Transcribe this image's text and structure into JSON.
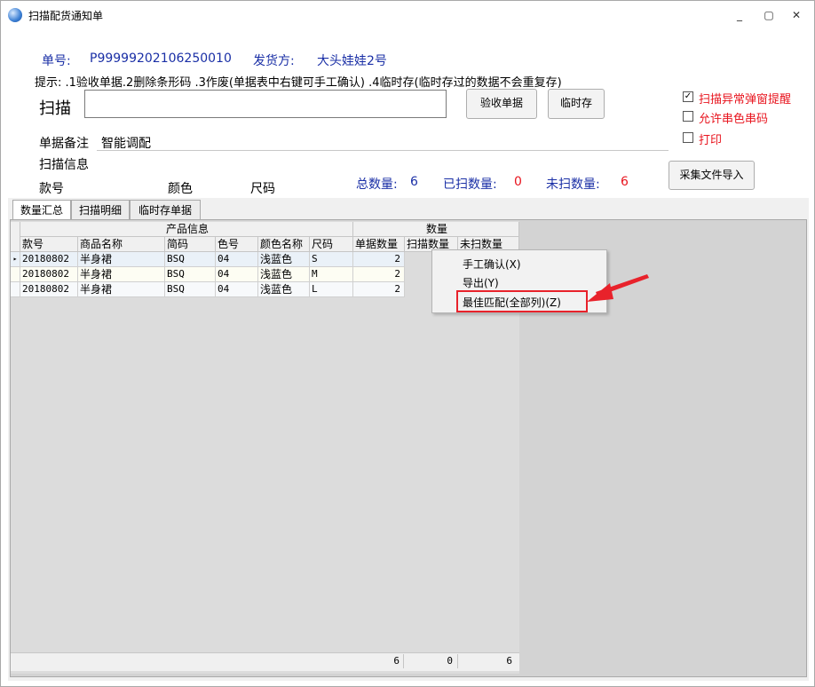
{
  "window": {
    "title": "扫描配货通知单",
    "controls": [
      "_",
      "▢",
      "✕"
    ]
  },
  "header": {
    "order_label": "单号:",
    "order_value": "P99999202106250010",
    "ship_label": "发货方:",
    "ship_value": "大头娃娃2号",
    "hint": "提示: .1验收单据.2删除条形码 .3作废(单据表中右键可手工确认) .4临时存(临时存过的数据不会重复存)"
  },
  "scan": {
    "label": "扫描",
    "value": "",
    "placeholder": "",
    "accept_button": "验收单据",
    "temp_save_button": "临时存"
  },
  "options": {
    "popup_alert": {
      "label": "扫描异常弹窗提醒",
      "checked": true
    },
    "allow_color_mix": {
      "label": "允许串色串码",
      "checked": false
    },
    "print": {
      "label": "打印",
      "checked": false
    }
  },
  "remark": {
    "label": "单据备注",
    "value": "智能调配"
  },
  "scan_info": {
    "label": "扫描信息",
    "style_label": "款号",
    "color_label": "颜色",
    "size_label": "尺码",
    "total_label": "总数量:",
    "total_value": "6",
    "scanned_label": "已扫数量:",
    "scanned_value": "0",
    "unscanned_label": "未扫数量:",
    "unscanned_value": "6",
    "import_button": "采集文件导入"
  },
  "tabs": [
    {
      "label": "数量汇总",
      "active": true
    },
    {
      "label": "扫描明细",
      "active": false
    },
    {
      "label": "临时存单据",
      "active": false
    }
  ],
  "table": {
    "group_product": "产品信息",
    "group_qty": "数量",
    "columns": [
      "款号",
      "商品名称",
      "简码",
      "色号",
      "颜色名称",
      "尺码",
      "单据数量",
      "扫描数量",
      "未扫数量"
    ],
    "rows": [
      [
        "20180802",
        "半身裙",
        "BSQ",
        "04",
        "浅蓝色",
        "S",
        "2",
        "",
        ""
      ],
      [
        "20180802",
        "半身裙",
        "BSQ",
        "04",
        "浅蓝色",
        "M",
        "2",
        "",
        ""
      ],
      [
        "20180802",
        "半身裙",
        "BSQ",
        "04",
        "浅蓝色",
        "L",
        "2",
        "",
        ""
      ]
    ],
    "totals": {
      "doc_qty": "6",
      "scanned_qty": "0",
      "unscanned_qty": "6"
    }
  },
  "context_menu": {
    "items": [
      "手工确认(X)",
      "导出(Y)",
      "最佳匹配(全部列)(Z)"
    ],
    "highlighted_index": 2
  },
  "colors": {
    "accent_blue": "#1a2fa6",
    "alert_red": "#e8141e",
    "annotation_red": "#e8222b"
  }
}
